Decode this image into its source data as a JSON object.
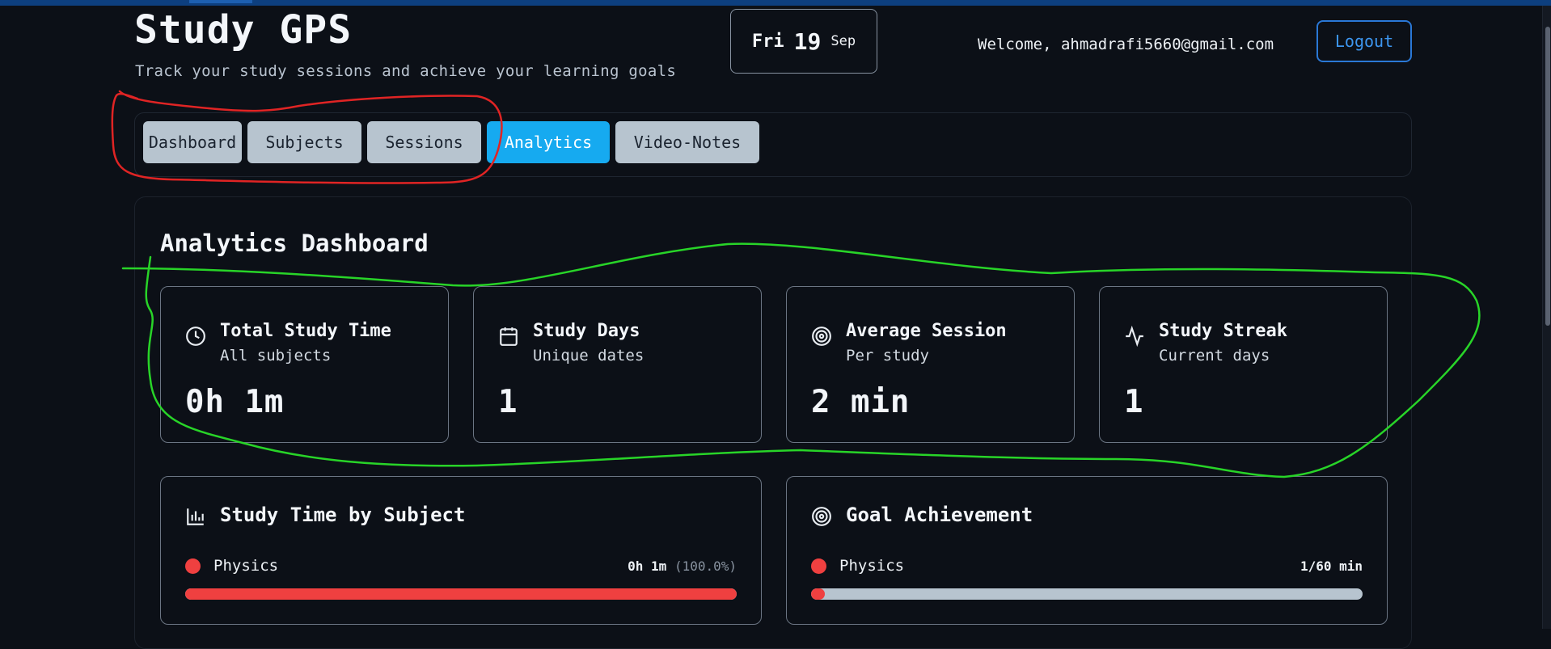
{
  "app": {
    "title": "Study GPS",
    "subtitle": "Track your study sessions and achieve your learning goals"
  },
  "date": {
    "weekday": "Fri",
    "day": "19",
    "month": "Sep"
  },
  "user": {
    "welcome": "Welcome, ahmadrafi5660@gmail.com",
    "logout_label": "Logout"
  },
  "nav": {
    "tabs": [
      {
        "label": "Dashboard",
        "active": false
      },
      {
        "label": "Subjects",
        "active": false
      },
      {
        "label": "Sessions",
        "active": false
      },
      {
        "label": "Analytics",
        "active": true
      },
      {
        "label": "Video-Notes",
        "active": false
      }
    ]
  },
  "analytics": {
    "title": "Analytics Dashboard",
    "stats": [
      {
        "icon": "clock-icon",
        "label": "Total Study Time",
        "sub": "All subjects",
        "value": "0h 1m"
      },
      {
        "icon": "calendar-icon",
        "label": "Study Days",
        "sub": "Unique dates",
        "value": "1"
      },
      {
        "icon": "target-icon",
        "label": "Average Session",
        "sub": "Per study",
        "value": "2 min"
      },
      {
        "icon": "activity-icon",
        "label": "Study Streak",
        "sub": "Current days",
        "value": "1"
      }
    ],
    "by_subject": {
      "title": "Study Time by Subject",
      "icon": "bar-chart-icon",
      "items": [
        {
          "name": "Physics",
          "time": "0h 1m",
          "percent_text": "(100.0%)",
          "fraction": 1.0,
          "color": "#ef4040"
        }
      ]
    },
    "goals": {
      "title": "Goal Achievement",
      "icon": "target-icon",
      "items": [
        {
          "name": "Physics",
          "progress_text": "1/60 min",
          "fraction": 0.0167,
          "color": "#ef4040"
        }
      ]
    }
  },
  "colors": {
    "background": "#0c1017",
    "accent": "#16aaf0",
    "logout": "#2a78d6",
    "subject": "#ef4040",
    "tab_inactive": "#b7c4cf"
  }
}
